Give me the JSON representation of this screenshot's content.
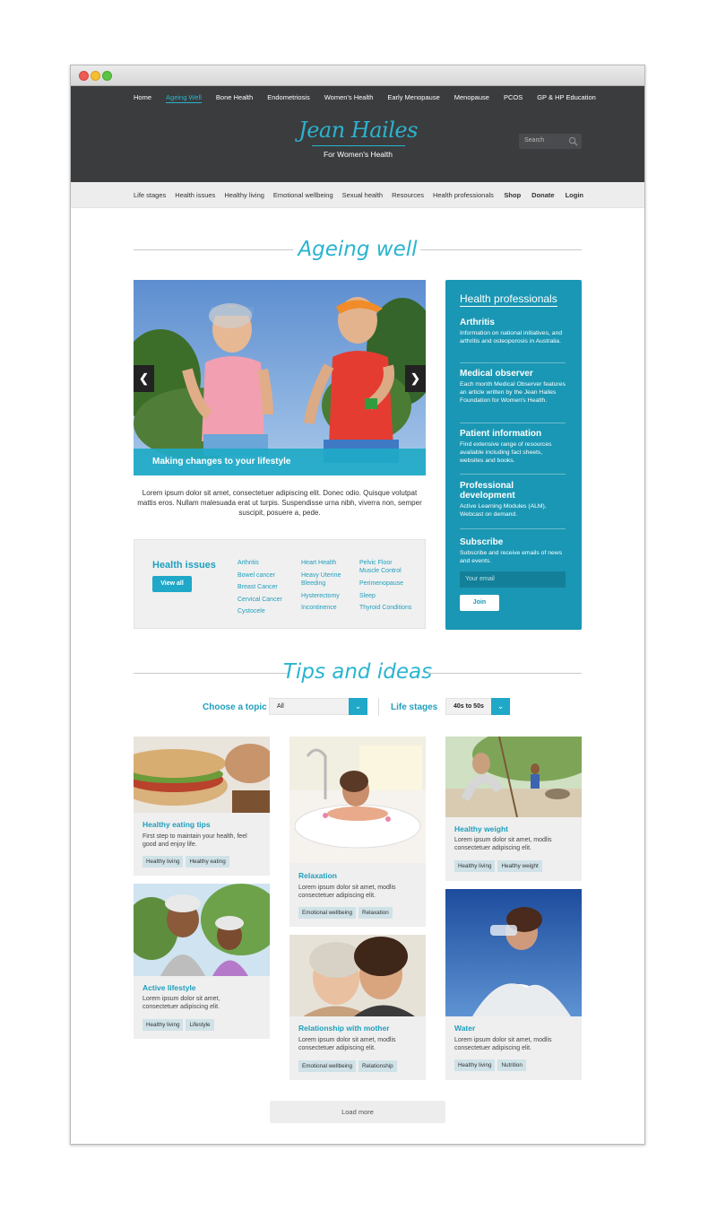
{
  "top_nav": [
    "Home",
    "Ageing Well",
    "Bone Health",
    "Endometriosis",
    "Women's Health",
    "Early Menopause",
    "Menopause",
    "PCOS",
    "GP & HP Education"
  ],
  "logo": {
    "name": "Jean Hailes",
    "tagline": "For Women's Health"
  },
  "search": {
    "placeholder": "Search"
  },
  "sub_nav": [
    "Life stages",
    "Health issues",
    "Healthy living",
    "Emotional wellbeing",
    "Sexual health",
    "Resources",
    "Health professionals"
  ],
  "sub_nav_right": [
    "Shop",
    "Donate",
    "Login"
  ],
  "page_title": "Ageing well",
  "hero": {
    "caption": "Making changes to your lifestyle",
    "description": "Lorem ipsum dolor sit amet, consectetuer adipiscing elit. Donec odio. Quisque volutpat mattis eros. Nullam malesuada erat ut turpis. Suspendisse urna nibh, viverra non, semper suscipit, posuere a, pede."
  },
  "health_issues": {
    "title": "Health issues",
    "button": "View all",
    "col1": [
      "Arthritis",
      "Bowel cancer",
      "Breast Cancer",
      "Cervical Cancer",
      "Cystocele"
    ],
    "col2": [
      "Heart Health",
      "Heavy Uterine Bleeding",
      "Hysterectomy",
      "Incontinence"
    ],
    "col3": [
      "Pelvic Floor Muscle Control",
      "Perimenopause",
      "Sleep",
      "Thyroid Conditions"
    ]
  },
  "sidebar": {
    "title": "Health professionals",
    "items": [
      {
        "title": "Arthritis",
        "text": "Information on national initiatives, and arthritis and osteoporosis in Australia."
      },
      {
        "title": "Medical observer",
        "text": "Each month Medical Observer features an article written by the Jean Hailes Foundation for Women's Health."
      },
      {
        "title": "Patient information",
        "text": "Find extensive range of resources available including fact sheets, websites and books."
      },
      {
        "title": "Professional development",
        "text": "Active Learning Modules (ALM), Webcast on demand."
      },
      {
        "title": "Subscribe",
        "text": "Subscribe and receive emails of news and events."
      }
    ],
    "email_placeholder": "Your email",
    "join": "Join"
  },
  "tips_title": "Tips and ideas",
  "filters": {
    "topic_label": "Choose a topic",
    "topic_value": "All",
    "stage_label": "Life stages",
    "stage_value": "40s to 50s"
  },
  "cards": [
    {
      "title": "Healthy eating tips",
      "desc": "First step to maintain your health, feel good and enjoy life.",
      "tags": [
        "Healthy living",
        "Healthy eating"
      ]
    },
    {
      "title": "Active lifestyle",
      "desc": "Lorem ipsum dolor sit amet, consectetuer adipiscing elit.",
      "tags": [
        "Healthy living",
        "Lifestyle"
      ]
    },
    {
      "title": "Relaxation",
      "desc": "Lorem ipsum dolor sit amet, modlis consectetuer adipiscing elit.",
      "tags": [
        "Emotional wellbeing",
        "Relaxation"
      ]
    },
    {
      "title": "Relationship with mother",
      "desc": "Lorem ipsum dolor sit amet, modlis consectetuer adipiscing elit.",
      "tags": [
        "Emotional wellbeing",
        "Relationship"
      ]
    },
    {
      "title": "Healthy weight",
      "desc": "Lorem ipsum dolor sit amet, modlis consectetuer adipiscing elit.",
      "tags": [
        "Healthy living",
        "Healthy weight"
      ]
    },
    {
      "title": "Water",
      "desc": "Lorem ipsum dolor sit amet, modlis consectetuer adipiscing elit.",
      "tags": [
        "Healthy living",
        "Nutrition"
      ]
    }
  ],
  "load_more": "Load more",
  "colors": {
    "accent": "#2ab4cf",
    "header_bg": "#3b3c3e",
    "sidebar_bg": "#1a97b4"
  }
}
